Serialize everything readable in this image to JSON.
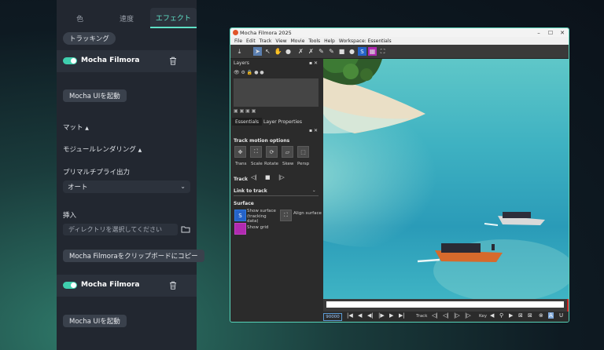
{
  "left_panel": {
    "tabs": [
      {
        "label": "色"
      },
      {
        "label": "速度"
      },
      {
        "label": "エフェクト",
        "active": true
      }
    ],
    "tracking_chip": "トラッキング",
    "effect_title": "Mocha Filmora",
    "launch_button": "Mocha UIを起動",
    "matte": "マット",
    "module_rendering": "モジュールレンダリング",
    "premultiply_output": "プリマルチプライ出力",
    "premultiply_value": "オート",
    "insert_label": "挿入",
    "directory_placeholder": "ディレクトリを選択してください",
    "copy_button": "Mocha Filmoraをクリップボードにコピー",
    "effect_title_2": "Mocha Filmora",
    "launch_button_2": "Mocha UIを起動"
  },
  "mocha": {
    "title": "Mocha Filmora 2025",
    "menu": [
      "File",
      "Edit",
      "Track",
      "View",
      "Movie",
      "Tools",
      "Help",
      "Workspace: Essentials"
    ],
    "layers_title": "Layers",
    "tabs": [
      "Essentials",
      "Layer Properties"
    ],
    "track_motion_title": "Track motion options",
    "motion_options": [
      "Trans",
      "Scale",
      "Rotate",
      "Skew",
      "Persp"
    ],
    "track_label": "Track",
    "link_to_track": "Link to track",
    "surface_title": "Surface",
    "show_surface": "Show surface (tracking data)",
    "align_surface": "Align surface",
    "show_grid": "Show grid",
    "frame": "90000",
    "status_track": "Track",
    "status_key": "Key"
  },
  "colors": {
    "accent": "#5fe0c6",
    "window_border": "#58d3b8"
  }
}
